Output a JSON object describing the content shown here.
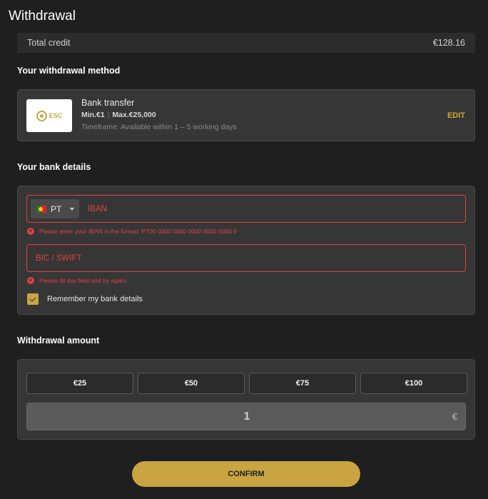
{
  "page": {
    "title": "Withdrawal"
  },
  "credit": {
    "label": "Total credit",
    "value": "€128.16"
  },
  "method": {
    "heading": "Your withdrawal method",
    "logo_text": "ESC",
    "name": "Bank transfer",
    "min": "Min.€1",
    "max": "Max.€25,000",
    "timeframe": "Timeframe: Available within 1 – 5 working days",
    "edit_label": "EDIT"
  },
  "bank": {
    "heading": "Your bank details",
    "country_code": "PT",
    "iban_placeholder": "IBAN",
    "iban_error": "Please enter your IBAN in the format: PT00 0000 0000 0000 0000 0000 0",
    "bic_placeholder": "BIC / SWIFT",
    "bic_error": "Please fill this field and try again.",
    "remember_label": "Remember my bank details",
    "remember_checked": true
  },
  "amount": {
    "heading": "Withdrawal amount",
    "presets": [
      "€25",
      "€50",
      "€75",
      "€100"
    ],
    "value": "1",
    "currency": "€"
  },
  "confirm_label": "CONFIRM",
  "colors": {
    "accent": "#c9a441",
    "error": "#e0413f",
    "background": "#1f1f1f",
    "panel": "#363636"
  }
}
